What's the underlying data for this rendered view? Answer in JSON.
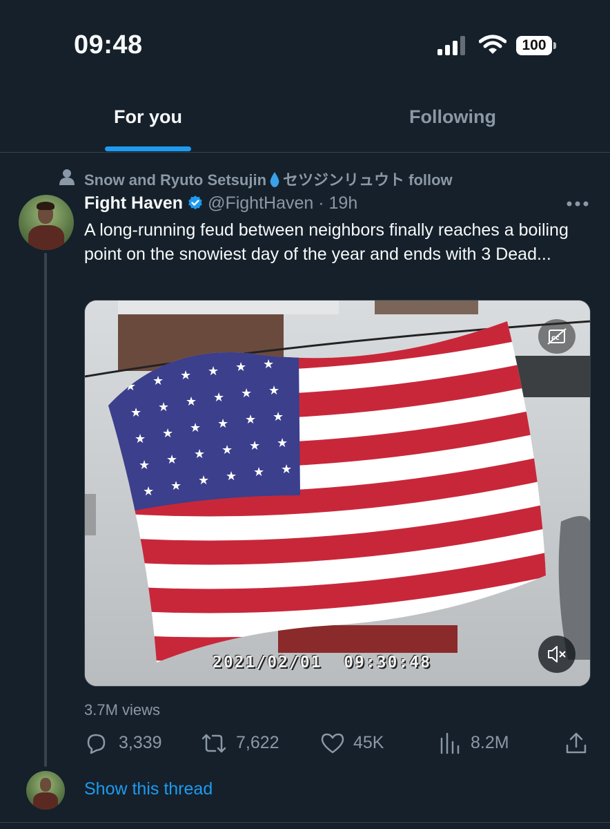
{
  "status_bar": {
    "time": "09:48",
    "battery": "100"
  },
  "tabs": [
    {
      "label": "For you",
      "active": true
    },
    {
      "label": "Following",
      "active": false
    }
  ],
  "social_context": {
    "name_part1": "Snow and Ryuto Setsujin",
    "name_part2": "セツジンリュウト follow"
  },
  "tweet": {
    "display_name": "Fight Haven",
    "handle_time": "@FightHaven · 19h",
    "text": "A long-running feud between neighbors finally reaches a boiling point on the snowiest day of the year and ends with 3 Dead...",
    "media_timestamp": "2021/02/01  09:30:48",
    "views_label": "3.7M views",
    "stats": {
      "replies": "3,339",
      "retweets": "7,622",
      "likes": "45K",
      "views": "8.2M"
    }
  },
  "thread_link": "Show this thread",
  "colors": {
    "background": "#15202b",
    "accent": "#1d9bf0",
    "muted": "#8b98a5",
    "divider": "#38444d"
  },
  "icons": [
    "signal-icon",
    "wifi-icon",
    "battery-icon",
    "person-icon",
    "droplet-icon",
    "verified-badge-icon",
    "more-icon",
    "captions-icon",
    "mute-icon",
    "reply-icon",
    "retweet-icon",
    "like-icon",
    "analytics-icon",
    "share-icon"
  ]
}
